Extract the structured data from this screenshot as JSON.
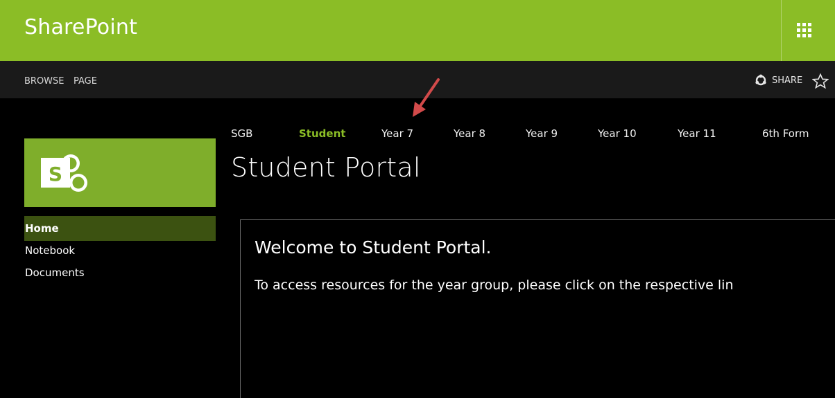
{
  "suite_bar": {
    "brand": "SharePoint",
    "app_launcher_icon": "waffle-grid-icon",
    "color": "#8bbd26"
  },
  "ribbon": {
    "tabs": [
      "BROWSE",
      "PAGE"
    ],
    "share_label": "SHARE",
    "share_icon": "share-icon",
    "follow_icon": "star-outline-icon"
  },
  "site": {
    "logo_icon": "sharepoint-logo-icon",
    "logo_letter": "S",
    "title": "Student Portal"
  },
  "top_nav": {
    "items": [
      "SGB",
      "Student",
      "Year 7",
      "Year 8",
      "Year 9",
      "Year 10",
      "Year 11",
      "6th Form"
    ],
    "selected": "Student",
    "selected_color": "#8bbd26"
  },
  "left_nav": {
    "items": [
      "Home",
      "Notebook",
      "Documents"
    ],
    "selected": "Home"
  },
  "content": {
    "welcome_heading": "Welcome to Student Portal.",
    "body_text": "To access resources for the year group, please click on the respective lin"
  },
  "annotation": {
    "arrow_color": "#d24a4a"
  }
}
